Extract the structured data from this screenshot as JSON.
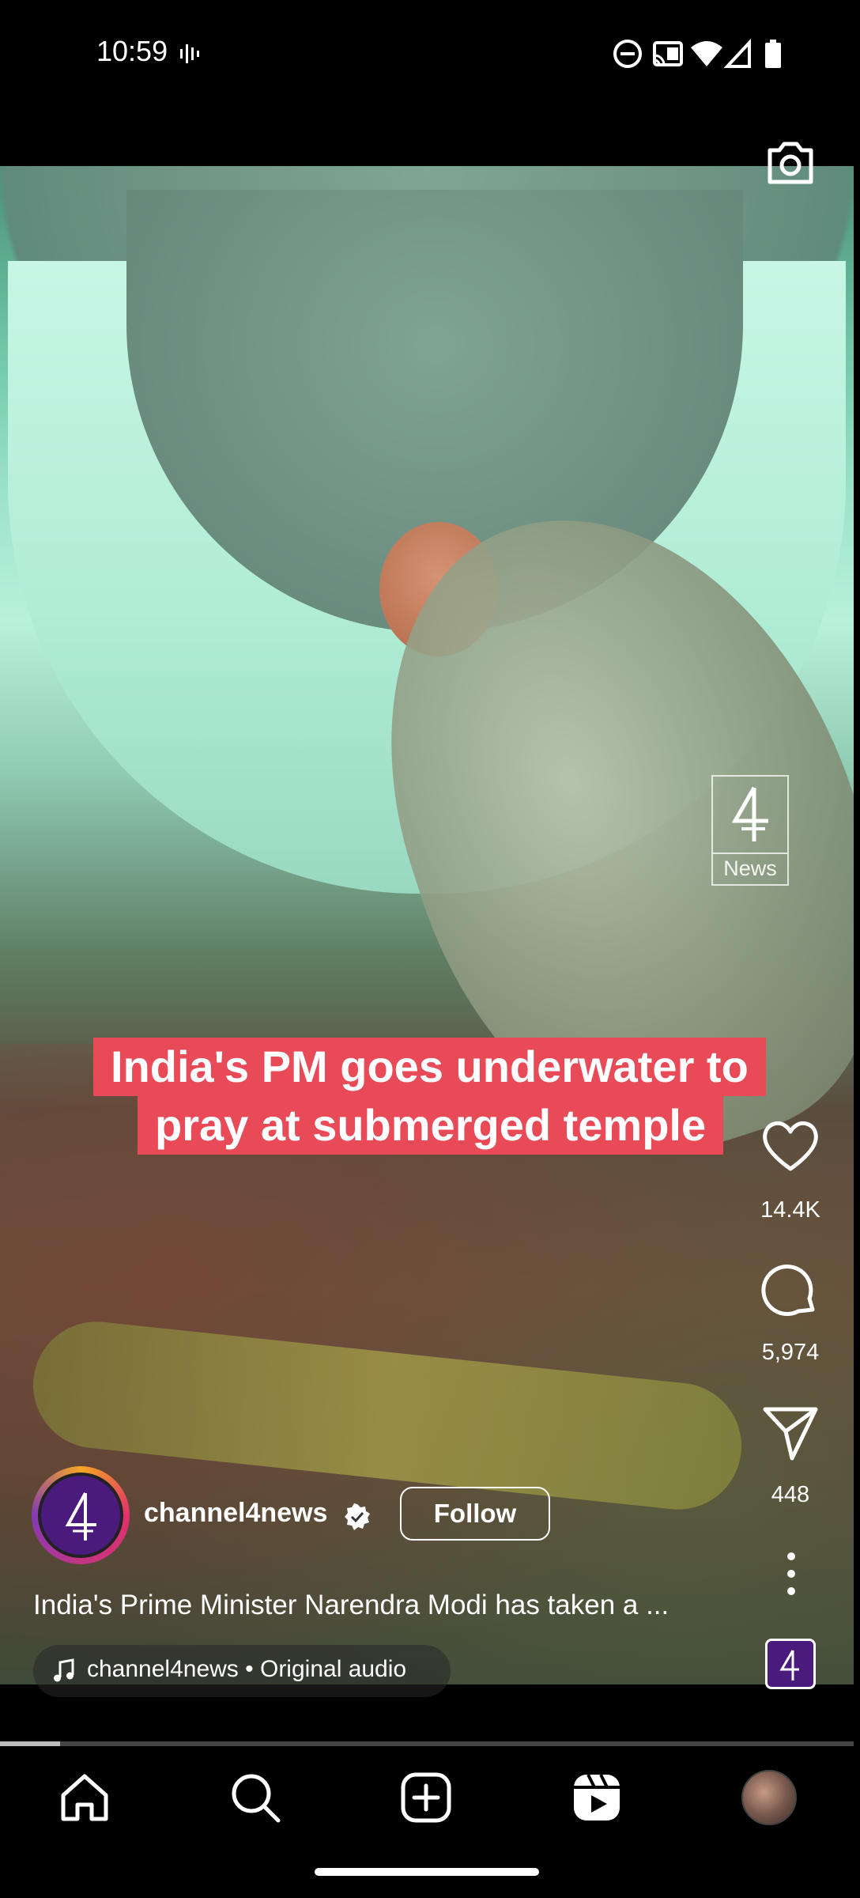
{
  "status_bar": {
    "time": "10:59",
    "icons": [
      "vibrate-icon",
      "do-not-disturb-icon",
      "cast-icon",
      "wifi-icon",
      "signal-icon",
      "battery-icon"
    ]
  },
  "video": {
    "caption_lines": [
      "India's PM goes underwater to",
      "pray at submerged temple"
    ],
    "watermark_label": "News",
    "caption_color": "#e84a58"
  },
  "actions": {
    "likes": "14.4K",
    "comments": "5,974",
    "shares": "448"
  },
  "post": {
    "username": "channel4news",
    "follow_label": "Follow",
    "caption": "India's Prime Minister Narendra Modi has taken a ...",
    "audio": "channel4news • Original audio"
  },
  "playback": {
    "progress": 0.07
  },
  "nav": {
    "items": [
      "home-icon",
      "search-icon",
      "create-icon",
      "reels-icon",
      "profile-avatar"
    ]
  },
  "colors": {
    "background": "#000000",
    "brand_purple": "#4b1a7d"
  }
}
